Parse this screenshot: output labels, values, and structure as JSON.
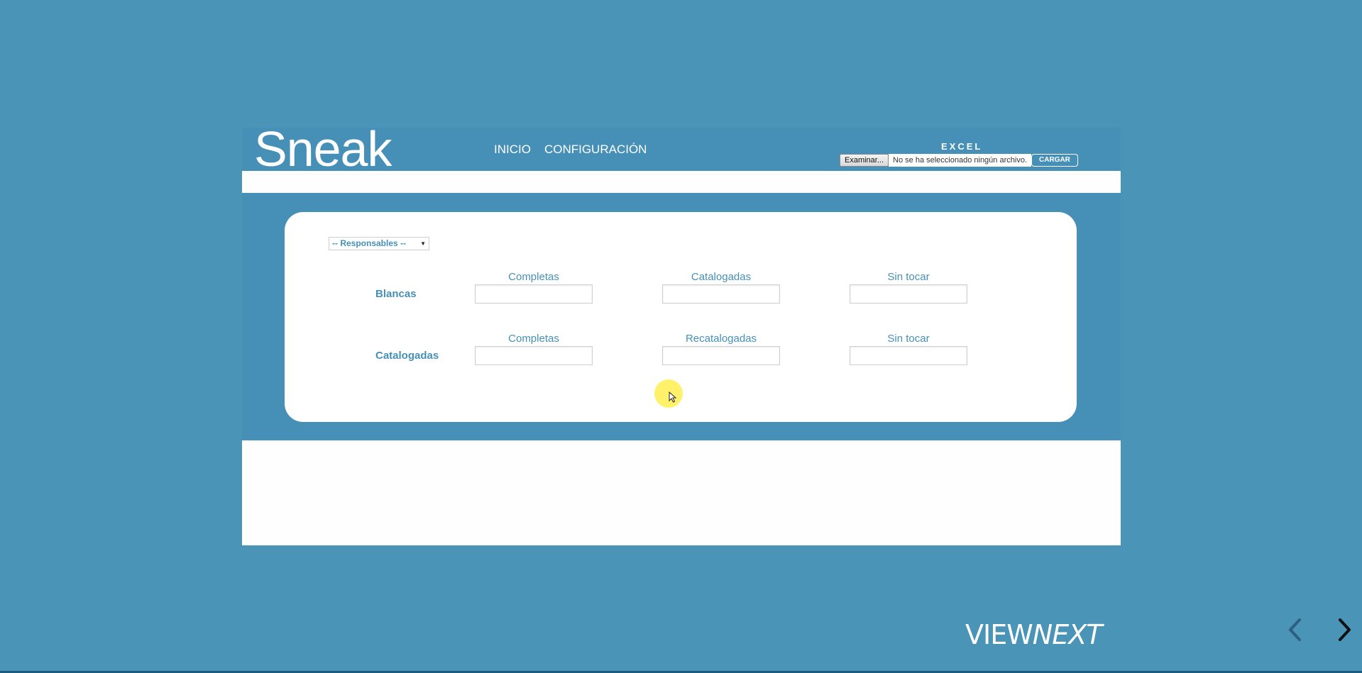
{
  "app": {
    "logo": "Sneak",
    "nav": [
      "INICIO",
      "CONFIGURACIÓN"
    ],
    "excel": {
      "title": "EXCEL",
      "browse_label": "Examinar...",
      "file_status": "No se ha seleccionado ningún archivo.",
      "upload_label": "CARGAR"
    }
  },
  "form": {
    "responsables_select": "-- Responsables --",
    "rows": [
      {
        "label": "Blancas",
        "columns": [
          "Completas",
          "Catalogadas",
          "Sin tocar"
        ],
        "values": [
          "",
          "",
          ""
        ]
      },
      {
        "label": "Catalogadas",
        "columns": [
          "Completas",
          "Recatalogadas",
          "Sin tocar"
        ],
        "values": [
          "",
          "",
          ""
        ]
      }
    ]
  },
  "presentation": {
    "brand_regular": "VIEW",
    "brand_italic": "NEXT",
    "prev_icon": "chevron-left-icon",
    "next_icon": "chevron-right-icon"
  },
  "colors": {
    "background": "#4a94b8",
    "header": "#4690b8",
    "accent_text": "#4690b8",
    "cursor_highlight": "#ffee50"
  }
}
